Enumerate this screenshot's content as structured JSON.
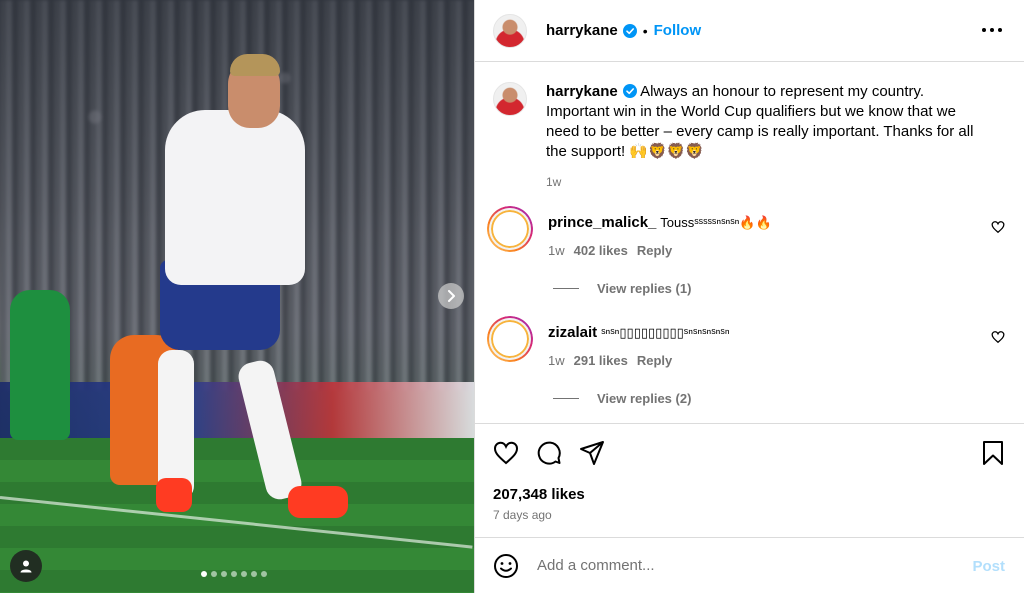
{
  "post": {
    "image_alt": "Harry Kane celebrating in England kit",
    "carousel_dots": 7,
    "carousel_active": 0
  },
  "header": {
    "username": "harrykane",
    "separator": "•",
    "follow_label": "Follow",
    "more_icon": "more-horizontal-icon"
  },
  "caption": {
    "username": "harrykane",
    "text": "Always an honour to represent my country. Important win in the World Cup qualifiers but we know that we need to be better – every camp is really important. Thanks for all the support! 🙌🦁🦁🦁",
    "time": "1w"
  },
  "comments": [
    {
      "username": "prince_malick_",
      "text": "Toussˢˢˢˢˢⁿˢⁿˢⁿ🔥🔥",
      "time": "1w",
      "likes": "402 likes",
      "reply_label": "Reply",
      "view_replies": "View replies (1)"
    },
    {
      "username": "zizalait",
      "text": "ˢⁿˢⁿ▯▯▯▯▯▯▯▯▯ˢⁿˢⁿˢⁿˢⁿˢⁿ",
      "time": "1w",
      "likes": "291 likes",
      "reply_label": "Reply",
      "view_replies": "View replies (2)"
    }
  ],
  "actions": {
    "likes": "207,348 likes",
    "date": "7 days ago"
  },
  "composer": {
    "placeholder": "Add a comment...",
    "post_label": "Post"
  },
  "colors": {
    "accent": "#0095f6",
    "post_disabled": "#b2dffc",
    "muted": "#737373",
    "border": "#dbdbdb"
  }
}
